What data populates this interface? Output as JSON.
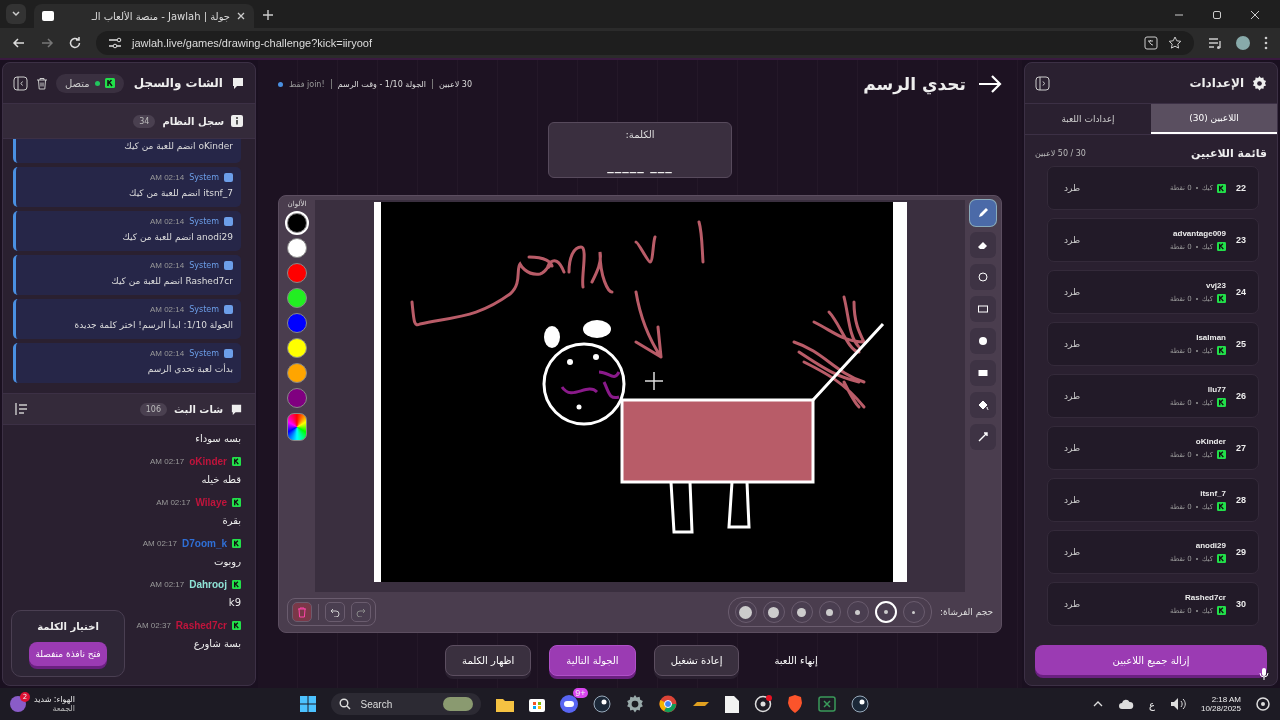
{
  "browser": {
    "tab_title": "جولة | Jawlah - منصة الألعاب الـ",
    "url": "jawlah.live/games/drawing-challenge?kick=iiryoof"
  },
  "chat_panel": {
    "title": "الشات والسجل",
    "status": "متصل",
    "connected": true,
    "system_log": {
      "title": "سجل النظام",
      "count": "34",
      "messages": [
        {
          "text": "oKinder انضم للعبة من كيك"
        },
        {
          "sender": "System",
          "time": "AM 02:14",
          "text": "itsnf_7 انضم للعبة من كيك"
        },
        {
          "sender": "System",
          "time": "AM 02:14",
          "text": "anodi29 انضم للعبة من كيك"
        },
        {
          "sender": "System",
          "time": "AM 02:14",
          "text": "Rashed7cr انضم للعبة من كيك"
        },
        {
          "sender": "System",
          "time": "AM 02:14",
          "text": "الجولة 1/10: ابدأ الرسم! اختر كلمة جديدة"
        },
        {
          "sender": "System",
          "time": "AM 02:14",
          "text": "بدأت لعبة تحدي الرسم"
        }
      ]
    },
    "stream_chat": {
      "title": "شات البث",
      "count": "106",
      "messages": [
        {
          "text": "بسه سوداء"
        },
        {
          "user": "oKinder",
          "color": "#c0143c",
          "time": "AM 02:17",
          "text": "قطه خيله"
        },
        {
          "user": "Wilaye",
          "color": "#c0143c",
          "time": "AM 02:17",
          "text": "بقرة"
        },
        {
          "user": "D7oom_k",
          "color": "#2f6fd6",
          "time": "AM 02:17",
          "text": "روبوت"
        },
        {
          "user": "Dahrooj",
          "color": "#8fe3d6",
          "time": "AM 02:17",
          "text": "k9"
        },
        {
          "user": "Rashed7cr",
          "color": "#c0143c",
          "time": "AM 02:37",
          "text": "بسة شاورع"
        }
      ]
    },
    "word_card": {
      "title": "اختيار الكلمة",
      "button": "فتح نافذة منفصلة"
    }
  },
  "game": {
    "title": "تحدي الرسم",
    "meta": [
      "30 لاعبين",
      "الجولة 1/10 - وقت الرسم",
      "!join فقط"
    ],
    "word": {
      "label": "الكلمة:",
      "hint": "_____ ___"
    },
    "colors_label": "الألوان",
    "palette": [
      {
        "color": "#000000",
        "selected": true
      },
      {
        "color": "#ffffff",
        "selected": false
      },
      {
        "color": "#ff0000",
        "selected": false
      },
      {
        "color": "#22ee22",
        "selected": false
      },
      {
        "color": "#0000ff",
        "selected": false
      },
      {
        "color": "#ffff00",
        "selected": false
      },
      {
        "color": "#ffa500",
        "selected": false
      },
      {
        "color": "#800080",
        "selected": false
      }
    ],
    "tools": [
      {
        "kind": "pen",
        "selected": true
      },
      {
        "kind": "eraser",
        "selected": false
      },
      {
        "kind": "circle",
        "selected": false
      },
      {
        "kind": "rect",
        "selected": false
      },
      {
        "kind": "filled-circle",
        "selected": false
      },
      {
        "kind": "filled-rect",
        "selected": false
      },
      {
        "kind": "bucket",
        "selected": false
      },
      {
        "kind": "line",
        "selected": false
      }
    ],
    "brush_label": "حجم الفرشاة:",
    "brush_sizes": [
      {
        "selected": false
      },
      {
        "selected": true
      },
      {
        "selected": false
      },
      {
        "selected": false
      },
      {
        "selected": false
      },
      {
        "selected": false
      },
      {
        "selected": false
      }
    ],
    "actions": [
      {
        "label": "إنهاء اللعبة",
        "kind": "plain"
      },
      {
        "label": "إعادة تشغيل",
        "kind": "secondary"
      },
      {
        "label": "الجولة التالية",
        "kind": "primary"
      },
      {
        "label": "اظهار الكلمة",
        "kind": "secondary"
      }
    ]
  },
  "settings_panel": {
    "title": "الإعدادات",
    "tabs": [
      {
        "label": "اللاعبين (30)",
        "selected": true
      },
      {
        "label": "إعدادات اللعبة",
        "selected": false
      }
    ],
    "list_title": "قائمة اللاعبين",
    "count": "30 / 50 لاعبين",
    "players": [
      {
        "rank": "22",
        "platform": "كيك",
        "points": "0 نقطة",
        "kick": "طرد"
      },
      {
        "rank": "23",
        "name": "advantage009",
        "platform": "كيك",
        "points": "0 نقطة",
        "kick": "طرد"
      },
      {
        "rank": "24",
        "name": "vvj23",
        "platform": "كيك",
        "points": "0 نقطة",
        "kick": "طرد"
      },
      {
        "rank": "25",
        "name": "Isalman",
        "platform": "كيك",
        "points": "0 نقطة",
        "kick": "طرد"
      },
      {
        "rank": "26",
        "name": "llu77",
        "platform": "كيك",
        "points": "0 نقطة",
        "kick": "طرد"
      },
      {
        "rank": "27",
        "name": "oKinder",
        "platform": "كيك",
        "points": "0 نقطة",
        "kick": "طرد"
      },
      {
        "rank": "28",
        "name": "itsnf_7",
        "platform": "كيك",
        "points": "0 نقطة",
        "kick": "طرد"
      },
      {
        "rank": "29",
        "name": "anodi29",
        "platform": "كيك",
        "points": "0 نقطة",
        "kick": "طرد"
      },
      {
        "rank": "30",
        "name": "Rashed7cr",
        "platform": "كيك",
        "points": "0 نقطة",
        "kick": "طرد"
      }
    ],
    "remove_all": "إزالة جميع اللاعبين"
  },
  "taskbar": {
    "weather": "الهواء: شديد",
    "day": "الجمعة",
    "weather_badge": "2",
    "search": {
      "placeholder": "Search"
    },
    "app_badge": "9+",
    "language": "ع",
    "time": "2:18 AM",
    "date": "10/28/2025"
  }
}
